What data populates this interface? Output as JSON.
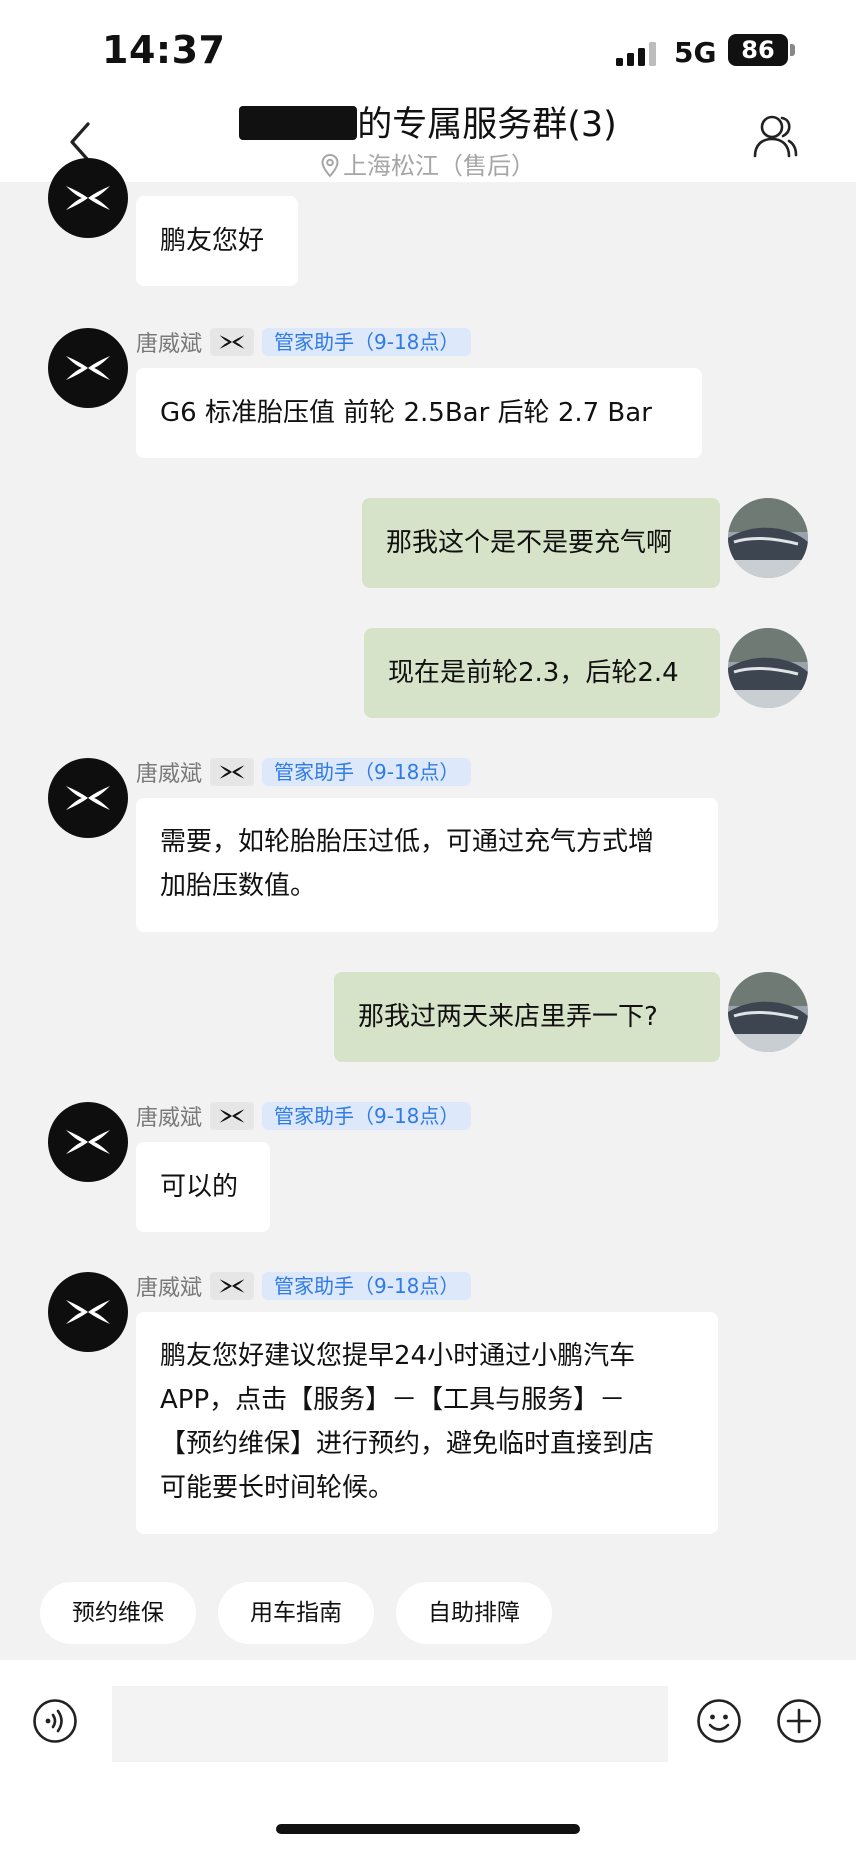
{
  "status_bar": {
    "time": "14:37",
    "network": "5G",
    "battery": "86"
  },
  "header": {
    "title_visible_start": "",
    "title_visible_end": "的专属服务群(3)",
    "subtitle": "上海松江（售后）"
  },
  "agent": {
    "name": "唐威斌",
    "role": "管家助手（9-18点）"
  },
  "messages": [
    {
      "from": "agent",
      "text": "鹏友您好"
    },
    {
      "from": "agent",
      "text": "G6 标准胎压值 前轮 2.5Bar 后轮 2.7 Bar"
    },
    {
      "from": "me",
      "text": "那我这个是不是要充气啊"
    },
    {
      "from": "me",
      "text": "现在是前轮2.3，后轮2.4"
    },
    {
      "from": "agent",
      "lines": [
        "需要，如轮胎胎压过低，可通过充气方式增",
        "加胎压数值。"
      ]
    },
    {
      "from": "me",
      "text": "那我过两天来店里弄一下?"
    },
    {
      "from": "agent",
      "text": "可以的"
    },
    {
      "from": "agent",
      "lines": [
        "鹏友您好建议您提早24小时通过小鹏汽车",
        "APP，点击【服务】－【工具与服务】－",
        "【预约维保】进行预约，避免临时直接到店",
        "可能要长时间轮候。"
      ]
    }
  ],
  "quick_replies": [
    "预约维保",
    "用车指南",
    "自助排障"
  ],
  "input": {
    "placeholder": ""
  },
  "icons": {
    "back": "chevron-left-icon",
    "members": "group-members-icon",
    "voice": "voice-icon",
    "emoji": "emoji-icon",
    "more": "plus-icon"
  }
}
